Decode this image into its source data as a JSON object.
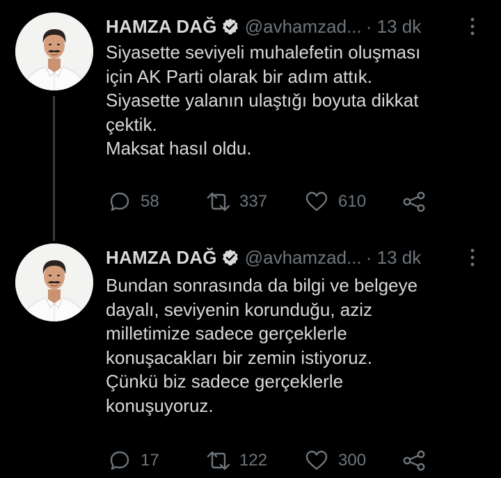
{
  "tweets": [
    {
      "author_name": "HAMZA DAĞ",
      "handle": "@avhamzad...",
      "time": "· 13 dk",
      "lines": [
        "Siyasette seviyeli muhalefetin oluşması",
        "için AK Parti olarak bir adım attık.",
        "Siyasette yalanın ulaştığı boyuta dikkat",
        "çektik.",
        "Maksat hasıl oldu."
      ],
      "replies": "58",
      "retweets": "337",
      "likes": "610"
    },
    {
      "author_name": "HAMZA DAĞ",
      "handle": "@avhamzad...",
      "time": "· 13 dk",
      "lines": [
        "Bundan sonrasında da bilgi ve belgeye",
        "dayalı, seviyenin korunduğu, aziz",
        "milletimize sadece gerçeklerle",
        "konuşacakları bir zemin istiyoruz.",
        "Çünkü biz sadece gerçeklerle",
        "konuşuyoruz."
      ],
      "replies": "17",
      "retweets": "122",
      "likes": "300"
    }
  ],
  "colors": {
    "background": "#000000",
    "text": "#d9d9d9",
    "secondary": "#6e767d",
    "thread_line": "#3a3d40"
  },
  "icons": [
    "verified-icon",
    "more-icon",
    "reply-icon",
    "retweet-icon",
    "like-icon",
    "share-icon"
  ]
}
